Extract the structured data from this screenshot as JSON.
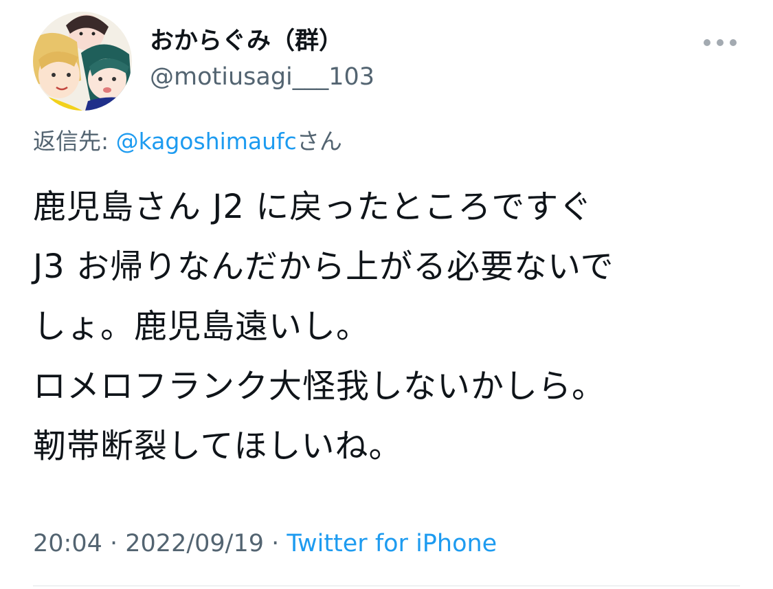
{
  "user": {
    "display_name": "おからぐみ（群）",
    "handle": "@motiusagi___103"
  },
  "reply": {
    "prefix": "返信先: ",
    "mention": "@kagoshimaufc",
    "suffix": "さん"
  },
  "body_lines": [
    "鹿児島さん J2 に戻ったところですぐ",
    "J3 お帰りなんだから上がる必要ないで",
    "しょ。鹿児島遠いし。",
    "ロメロフランク大怪我しないかしら。",
    "靭帯断裂してほしいね。"
  ],
  "meta": {
    "time": "20:04",
    "sep1": " · ",
    "date": "2022/09/19",
    "sep2": " · ",
    "source": "Twitter for iPhone"
  },
  "icons": {
    "more": "more-horizontal-icon",
    "avatar": "avatar-image"
  },
  "colors": {
    "text": "#0f1419",
    "secondary": "#536471",
    "link": "#1d9bf0"
  }
}
